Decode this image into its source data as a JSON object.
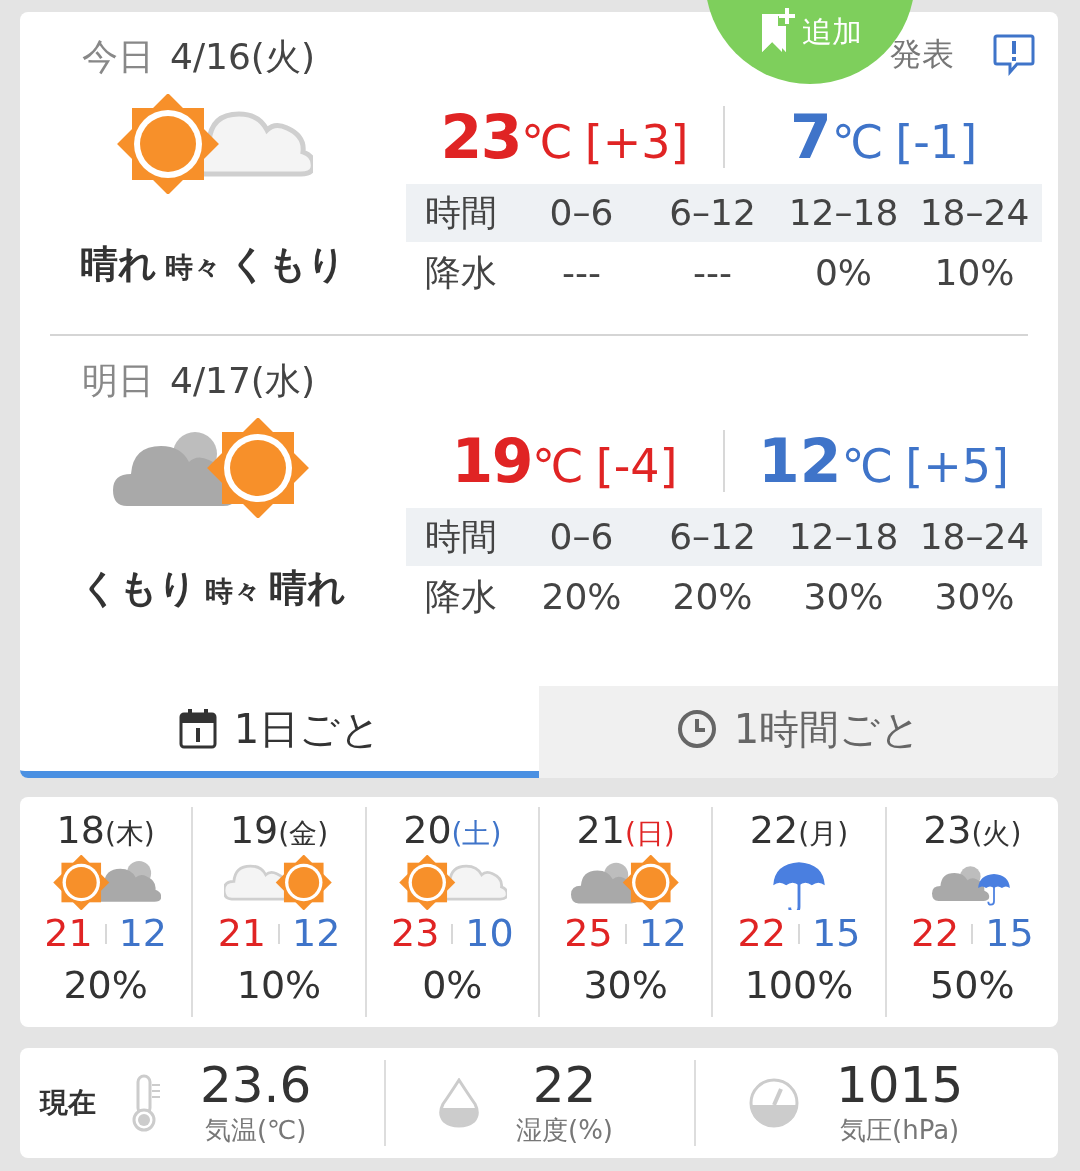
{
  "add_button": {
    "label": "追加"
  },
  "announcement": {
    "text": "発表"
  },
  "forecast_days": [
    {
      "date_label": "今日",
      "date": "4/16(火)",
      "kind": "sun_cloud_light",
      "weather": [
        "晴れ",
        "時々",
        "くもり"
      ],
      "high": {
        "value": "23",
        "unit": "℃",
        "diff": "[+3]"
      },
      "low": {
        "value": "7",
        "unit": "℃",
        "diff": "[-1]"
      },
      "time_row": [
        "時間",
        "0–6",
        "6–12",
        "12–18",
        "18–24"
      ],
      "precip_row": [
        "降水",
        "---",
        "---",
        "0%",
        "10%"
      ]
    },
    {
      "date_label": "明日",
      "date": "4/17(水)",
      "kind": "cloud_sun",
      "weather": [
        "くもり",
        "時々",
        "晴れ"
      ],
      "high": {
        "value": "19",
        "unit": "℃",
        "diff": "[-4]"
      },
      "low": {
        "value": "12",
        "unit": "℃",
        "diff": "[+5]"
      },
      "time_row": [
        "時間",
        "0–6",
        "6–12",
        "12–18",
        "18–24"
      ],
      "precip_row": [
        "降水",
        "20%",
        "20%",
        "30%",
        "30%"
      ]
    }
  ],
  "tabs": [
    {
      "label": "1日ごと",
      "kind": "calendar",
      "selected": true
    },
    {
      "label": "1時間ごと",
      "kind": "clock",
      "selected": false
    }
  ],
  "week": [
    {
      "day": "18",
      "weekday": "(木)",
      "color": "#333333",
      "kind": "sun_cloud",
      "high": "21",
      "low": "12",
      "precip": "20%"
    },
    {
      "day": "19",
      "weekday": "(金)",
      "color": "#333333",
      "kind": "cloud_light_sun",
      "high": "21",
      "low": "12",
      "precip": "10%"
    },
    {
      "day": "20",
      "weekday": "(土)",
      "color": "#3f74c9",
      "kind": "sun_cloud_light",
      "high": "23",
      "low": "10",
      "precip": "0%"
    },
    {
      "day": "21",
      "weekday": "(日)",
      "color": "#e02424",
      "kind": "cloud_sun",
      "high": "25",
      "low": "12",
      "precip": "30%"
    },
    {
      "day": "22",
      "weekday": "(月)",
      "color": "#333333",
      "kind": "rain",
      "high": "22",
      "low": "15",
      "precip": "100%"
    },
    {
      "day": "23",
      "weekday": "(火)",
      "color": "#333333",
      "kind": "cloud_rain",
      "high": "22",
      "low": "15",
      "precip": "50%"
    }
  ],
  "current": {
    "label": "現在",
    "items": [
      {
        "kind": "thermometer",
        "value": "23.6",
        "label": "気温(℃)"
      },
      {
        "kind": "drop",
        "value": "22",
        "label": "湿度(%)"
      },
      {
        "kind": "gauge",
        "value": "1015",
        "label": "気圧(hPa)"
      }
    ]
  }
}
